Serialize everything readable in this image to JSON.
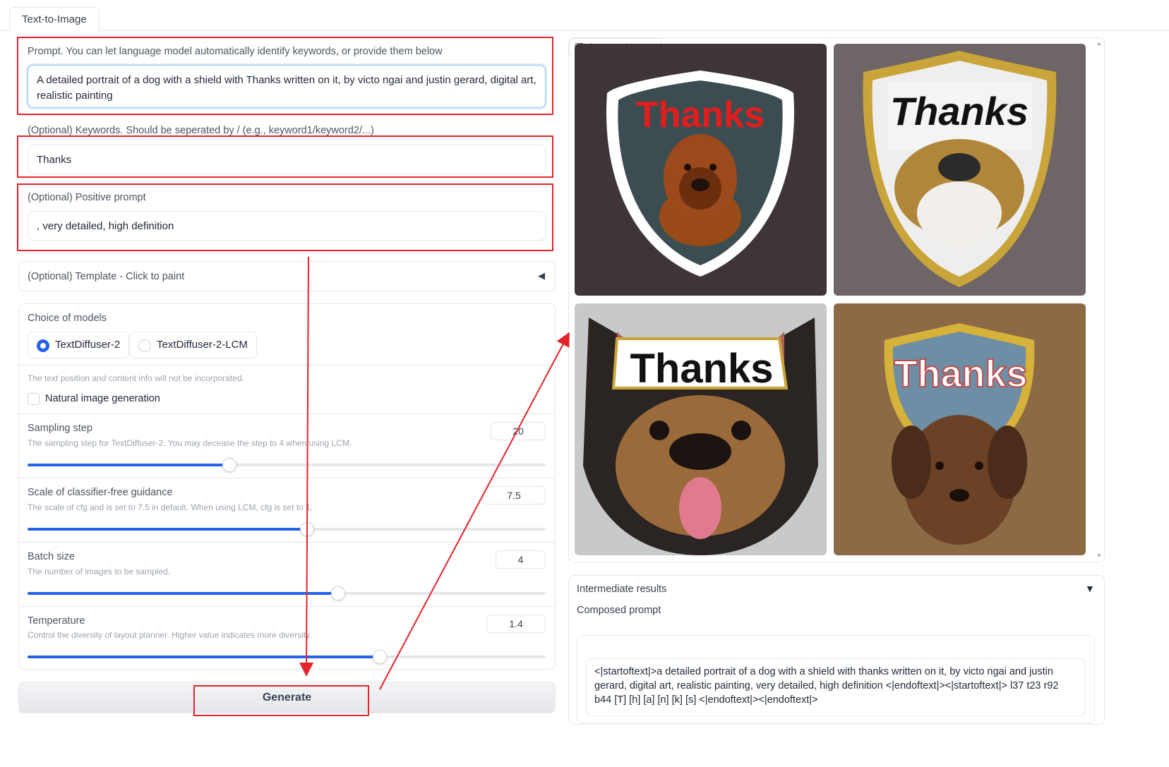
{
  "tabs": [
    {
      "label": "Text-to-Image"
    }
  ],
  "prompt": {
    "label": "Prompt. You can let language model automatically identify keywords, or provide them below",
    "value": "A detailed portrait of a dog with a shield with Thanks written on it, by victo ngai and justin gerard, digital art, realistic painting"
  },
  "keywords": {
    "label": "(Optional) Keywords. Should be seperated by / (e.g., keyword1/keyword2/...)",
    "value": "Thanks"
  },
  "positive_prompt": {
    "label": "(Optional) Positive prompt",
    "value": ",  very detailed,  high definition"
  },
  "template": {
    "label": "(Optional) Template - Click to paint",
    "arrow": "◀"
  },
  "models": {
    "label": "Choice of models",
    "options": [
      "TextDiffuser-2",
      "TextDiffuser-2-LCM"
    ],
    "selected": "TextDiffuser-2"
  },
  "natural": {
    "info": "The text position and content info will not be incorporated.",
    "label": "Natural image generation",
    "checked": false
  },
  "sliders": [
    {
      "label": "Sampling step",
      "info": "The sampling step for TextDiffuser-2. You may decease the step to 4 when using LCM.",
      "value": "20",
      "fraction": 0.39
    },
    {
      "label": "Scale of classifier-free guidance",
      "info": "The scale of cfg and is set to 7.5 in default. When using LCM, cfg is set to 1.",
      "value": "7.5",
      "fraction": 0.54
    },
    {
      "label": "Batch size",
      "info": "The number of images to be sampled.",
      "value": "4",
      "fraction": 0.6
    },
    {
      "label": "Temperature",
      "info": "Control the diversity of layout planner. Higher value indicates more diversity.",
      "value": "1.4",
      "fraction": 0.68
    }
  ],
  "generate_label": "Generate",
  "gallery": {
    "label": "Generated image",
    "images": [
      {
        "text": "Thanks",
        "desc": "dog on dark shield"
      },
      {
        "text": "Thanks",
        "desc": "bulldog with white shield"
      },
      {
        "text": "Thanks",
        "desc": "pug with sign"
      },
      {
        "text": "Thanks",
        "desc": "brown dog with blue shield"
      }
    ],
    "share_icon": "share-icon"
  },
  "intermediate": {
    "label": "Intermediate results",
    "arrow": "▼",
    "composed_label": "Composed prompt",
    "composed_text": "<|startoftext|>a detailed portrait of a dog with a shield with thanks written on it, by victo ngai and justin gerard, digital art, realistic painting, very detailed, high definition <|endoftext|><|startoftext|> l37 t23 r92 b44 [T] [h] [a] [n] [k] [s] <|endoftext|><|endoftext|>"
  },
  "colors": {
    "accent": "#2563eb",
    "annotation": "#e5232a"
  }
}
